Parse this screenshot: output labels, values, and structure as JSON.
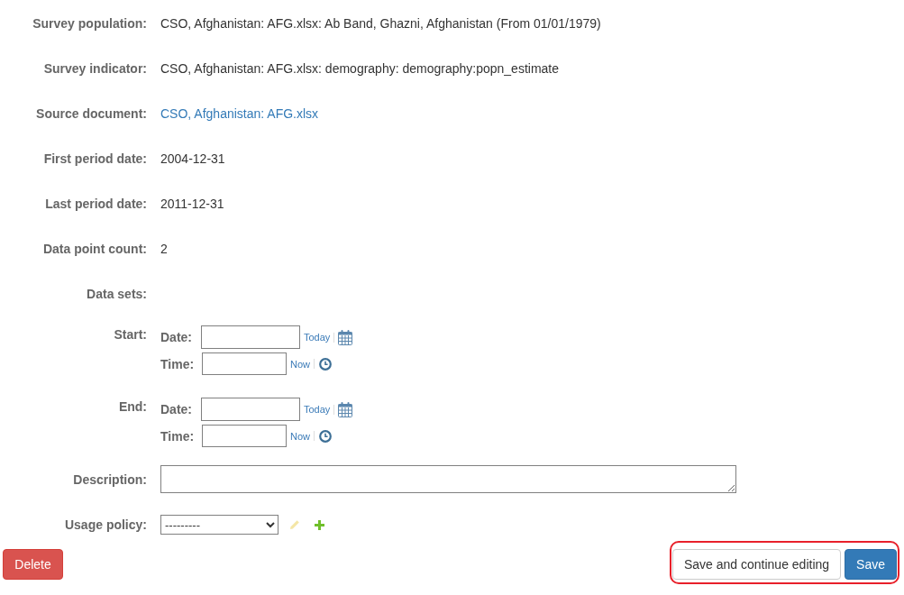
{
  "fields": [
    {
      "kind": "text",
      "label": "Survey population:",
      "value": "CSO, Afghanistan: AFG.xlsx: Ab Band, Ghazni, Afghanistan (From 01/01/1979)"
    },
    {
      "kind": "text",
      "label": "Survey indicator:",
      "value": "CSO, Afghanistan: AFG.xlsx: demography: demography:popn_estimate"
    },
    {
      "kind": "link",
      "label": "Source document:",
      "value": "CSO, Afghanistan: AFG.xlsx"
    },
    {
      "kind": "text",
      "label": "First period date:",
      "value": "2004-12-31"
    },
    {
      "kind": "text",
      "label": "Last period date:",
      "value": "2011-12-31"
    },
    {
      "kind": "text",
      "label": "Data point count:",
      "value": "2"
    },
    {
      "kind": "heading",
      "label": "Data sets:"
    },
    {
      "kind": "datetime",
      "label": "Start:",
      "date_label": "Date:",
      "today_link": "Today",
      "time_label": "Time:",
      "now_link": "Now"
    },
    {
      "kind": "datetime",
      "label": "End:",
      "date_label": "Date:",
      "today_link": "Today",
      "time_label": "Time:",
      "now_link": "Now"
    },
    {
      "kind": "textarea",
      "label": "Description:"
    },
    {
      "kind": "select",
      "label": "Usage policy:",
      "value": "---------",
      "edit_disabled": true
    }
  ],
  "delete_button": "Delete",
  "actions": {
    "highlighted": true,
    "buttons": [
      {
        "kind": "default",
        "label": "Save and continue editing"
      },
      {
        "kind": "primary",
        "label": "Save"
      }
    ]
  }
}
